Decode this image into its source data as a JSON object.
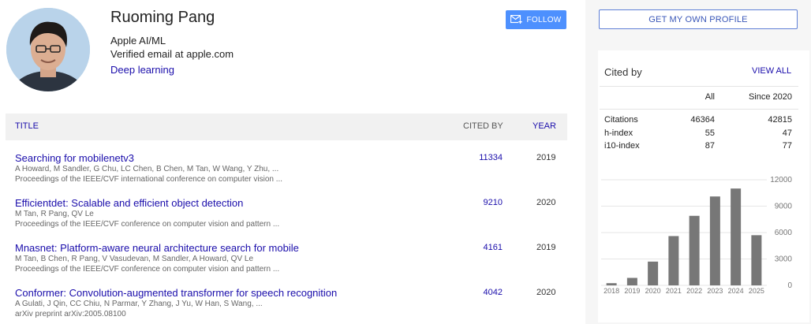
{
  "profile": {
    "name": "Ruoming Pang",
    "affiliation": "Apple AI/ML",
    "email": "Verified email at apple.com",
    "interest": "Deep learning",
    "follow_label": "FOLLOW"
  },
  "table": {
    "headers": {
      "title": "TITLE",
      "cited_by": "CITED BY",
      "year": "YEAR"
    },
    "rows": [
      {
        "title": "Searching for mobilenetv3",
        "authors": "A Howard, M Sandler, G Chu, LC Chen, B Chen, M Tan, W Wang, Y Zhu, ...",
        "venue": "Proceedings of the IEEE/CVF international conference on computer vision ...",
        "cited": "11334",
        "year": "2019"
      },
      {
        "title": "Efficientdet: Scalable and efficient object detection",
        "authors": "M Tan, R Pang, QV Le",
        "venue": "Proceedings of the IEEE/CVF conference on computer vision and pattern ...",
        "cited": "9210",
        "year": "2020"
      },
      {
        "title": "Mnasnet: Platform-aware neural architecture search for mobile",
        "authors": "M Tan, B Chen, R Pang, V Vasudevan, M Sandler, A Howard, QV Le",
        "venue": "Proceedings of the IEEE/CVF conference on computer vision and pattern ...",
        "cited": "4161",
        "year": "2019"
      },
      {
        "title": "Conformer: Convolution-augmented transformer for speech recognition",
        "authors": "A Gulati, J Qin, CC Chiu, N Parmar, Y Zhang, J Yu, W Han, S Wang, ...",
        "venue": "arXiv preprint arXiv:2005.08100",
        "cited": "4042",
        "year": "2020"
      }
    ]
  },
  "sidebar": {
    "get_profile_label": "GET MY OWN PROFILE",
    "cited_by_label": "Cited by",
    "view_all_label": "VIEW ALL",
    "col_all": "All",
    "col_since": "Since 2020",
    "stats": [
      {
        "label": "Citations",
        "all": "46364",
        "since": "42815"
      },
      {
        "label": "h-index",
        "all": "55",
        "since": "47"
      },
      {
        "label": "i10-index",
        "all": "87",
        "since": "77"
      }
    ]
  },
  "colors": {
    "link": "#1a0dab",
    "bar": "#777777",
    "follow_bg": "#4d90fe"
  },
  "icons": {
    "follow": "mail-plus-icon"
  },
  "chart_data": {
    "type": "bar",
    "categories": [
      "2018",
      "2019",
      "2020",
      "2021",
      "2022",
      "2023",
      "2024",
      "2025"
    ],
    "values": [
      250,
      850,
      2700,
      5600,
      7900,
      10100,
      11000,
      5700
    ],
    "yticks": [
      "12000",
      "9000",
      "6000",
      "3000",
      "0"
    ],
    "ylim": [
      0,
      12000
    ],
    "grid": true
  }
}
